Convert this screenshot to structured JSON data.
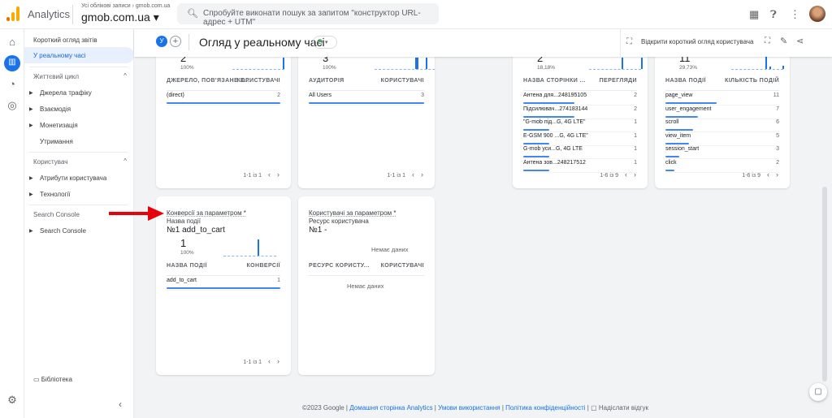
{
  "topbar": {
    "app_name": "Analytics",
    "breadcrumb": "Усі облікові записи › gmob.com.ua",
    "property": "gmob.com.ua ▾",
    "search_placeholder": "Спробуйте виконати пошук за запитом \"конструктор URL-адрес + UTM\""
  },
  "nav": {
    "overview": "Короткий огляд звітів",
    "realtime": "У реальному часі",
    "lifecycle": "Життєвий цикл",
    "traffic": "Джерела трафіку",
    "engagement": "Взаємодія",
    "monetization": "Монетизація",
    "retention": "Утримання",
    "user": "Користувач",
    "user_attributes": "Атрибути користувача",
    "tech": "Технології",
    "sc_section": "Search Console",
    "sc_item": "Search Console",
    "library": "Бібліотека"
  },
  "header": {
    "avatar_letter": "У",
    "title": "Огляд у реальному часі",
    "open_user_snapshot": "Відкрити короткий огляд користувача"
  },
  "cards": [
    {
      "total": "2",
      "pct": "100%",
      "col1": "ДЖЕРЕЛО, ПОВ'ЯЗАНЕ З...",
      "col2": "КОРИСТУВАЧІ",
      "rows": [
        {
          "label": "(direct)",
          "value": 2
        }
      ],
      "pager": "1-1 із 1"
    },
    {
      "total": "3",
      "pct": "100%",
      "col1": "АУДИТОРІЯ",
      "col2": "КОРИСТУВАЧІ",
      "rows": [
        {
          "label": "All Users",
          "value": 3
        }
      ],
      "pager": "1-1 із 1"
    },
    {
      "total": "2",
      "pct": "18,18%",
      "col1": "НАЗВА СТОРІНКИ ...",
      "col2": "ПЕРЕГЛЯДИ",
      "rows": [
        {
          "label": "Антена для...248195105",
          "value": 2
        },
        {
          "label": "Підсилювач...274183144",
          "value": 2
        },
        {
          "label": "\"G-mob під...G, 4G LTE\"",
          "value": 1
        },
        {
          "label": "E-GSM 900 ...G, 4G LTE\"",
          "value": 1
        },
        {
          "label": "G-mob уси...G, 4G LTE",
          "value": 1
        },
        {
          "label": "Антена зов...248217512",
          "value": 1
        }
      ],
      "pager": "1-6 із 9"
    },
    {
      "total": "11",
      "pct": "29,73%",
      "col1": "НАЗВА ПОДІЇ",
      "col2": "КІЛЬКІСТЬ ПОДІЙ",
      "rows": [
        {
          "label": "page_view",
          "value": 11
        },
        {
          "label": "user_engagement",
          "value": 7
        },
        {
          "label": "scroll",
          "value": 6
        },
        {
          "label": "view_item",
          "value": 5
        },
        {
          "label": "session_start",
          "value": 3
        },
        {
          "label": "click",
          "value": 2
        }
      ],
      "pager": "1-6 із 9"
    },
    {
      "title": "Конверсії за параметром *",
      "subtitle": "Назва події",
      "top": "№1 add_to_cart",
      "total": "1",
      "pct": "100%",
      "col1": "НАЗВА ПОДІЇ",
      "col2": "КОНВЕРСІЇ",
      "rows": [
        {
          "label": "add_to_cart",
          "value": 1
        }
      ],
      "pager": "1-1 із 1"
    },
    {
      "title": "Користувачі за параметром *",
      "subtitle": "Ресурс користувача",
      "top": "№1 -",
      "no_data_chart": "Немає даних",
      "col1": "РЕСУРС КОРИСТУ...",
      "col2": "КОРИСТУВАЧІ",
      "no_data_table": "Немає даних"
    }
  ],
  "footer": {
    "copyright": "©2023 Google |",
    "home": "Домашня сторінка Analytics",
    "terms": "Умови використання",
    "privacy": "Політика конфіденційності",
    "feedback": "Надіслати відгук"
  },
  "colors": {
    "accent": "#1a73e8",
    "arrow": "#e8000b"
  }
}
